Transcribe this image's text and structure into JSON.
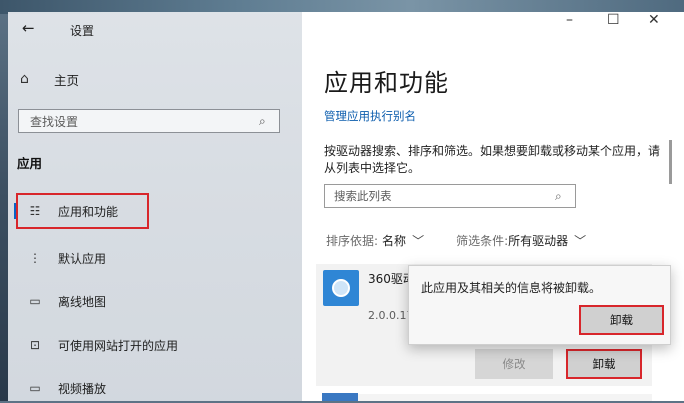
{
  "window": {
    "title": "设置",
    "minimize": "–",
    "maximize": "☐",
    "close": "✕"
  },
  "left": {
    "back_icon": "←",
    "home_label": "主页",
    "search_placeholder": "查找设置",
    "section_title": "应用",
    "nav": [
      {
        "label": "应用和功能",
        "icon": "apps-list-icon",
        "glyph": "☷",
        "selected": true
      },
      {
        "label": "默认应用",
        "icon": "default-apps-icon",
        "glyph": "⋮"
      },
      {
        "label": "离线地图",
        "icon": "offline-map-icon",
        "glyph": "▭"
      },
      {
        "label": "可使用网站打开的应用",
        "icon": "website-apps-icon",
        "glyph": "⊡"
      },
      {
        "label": "视频播放",
        "icon": "video-icon",
        "glyph": "▭"
      }
    ]
  },
  "right": {
    "page_title": "应用和功能",
    "alias_link": "管理应用执行别名",
    "description": "按驱动器搜索、排序和筛选。如果想要卸载或移动某个应用，请从列表中选择它。",
    "list_search_placeholder": "搜索此列表",
    "sort_label": "排序依据:",
    "sort_value": "名称",
    "filter_label": "筛选条件:",
    "filter_value": "所有驱动器",
    "app": {
      "name": "360驱动",
      "version": "2.0.0.17",
      "modify_label": "修改",
      "uninstall_label": "卸载"
    },
    "flyout": {
      "message": "此应用及其相关的信息将被卸载。",
      "uninstall_label": "卸载"
    }
  },
  "colors": {
    "accent": "#0b63c6",
    "highlight_box": "#d8262b"
  }
}
